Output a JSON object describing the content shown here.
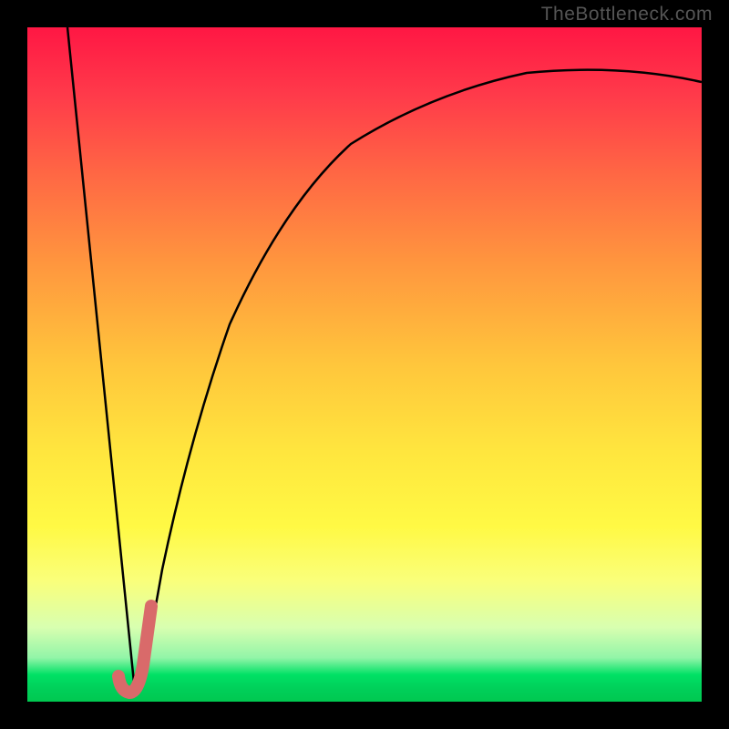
{
  "watermark": "TheBottleneck.com",
  "chart_data": {
    "type": "line",
    "title": "",
    "xlabel": "",
    "ylabel": "",
    "xlim": [
      0,
      100
    ],
    "ylim": [
      0,
      100
    ],
    "description": "V-shaped curve plot on a vertical gradient background; left branch is a steep straight descending line, right branch is an asymptotic rising curve. A short coral-colored J-shaped marker sits at the valley.",
    "series": [
      {
        "name": "left-line",
        "x": [
          6,
          16
        ],
        "y": [
          100,
          1.5
        ]
      },
      {
        "name": "right-curve",
        "x": [
          16,
          17,
          18,
          20,
          24,
          30,
          38,
          48,
          60,
          74,
          88,
          100
        ],
        "y": [
          1.5,
          3,
          8,
          20,
          39,
          56,
          69,
          78,
          84,
          88,
          90.5,
          92
        ]
      },
      {
        "name": "j-marker",
        "x": [
          13.5,
          14,
          15,
          16,
          17,
          18.3
        ],
        "y": [
          3.5,
          2,
          1.5,
          1.6,
          5,
          14
        ]
      }
    ],
    "colors": {
      "curve": "#000000",
      "marker": "#d96a6a",
      "gradient_top": "#ff1744",
      "gradient_mid": "#ffe63e",
      "gradient_bottom": "#00c850"
    }
  }
}
